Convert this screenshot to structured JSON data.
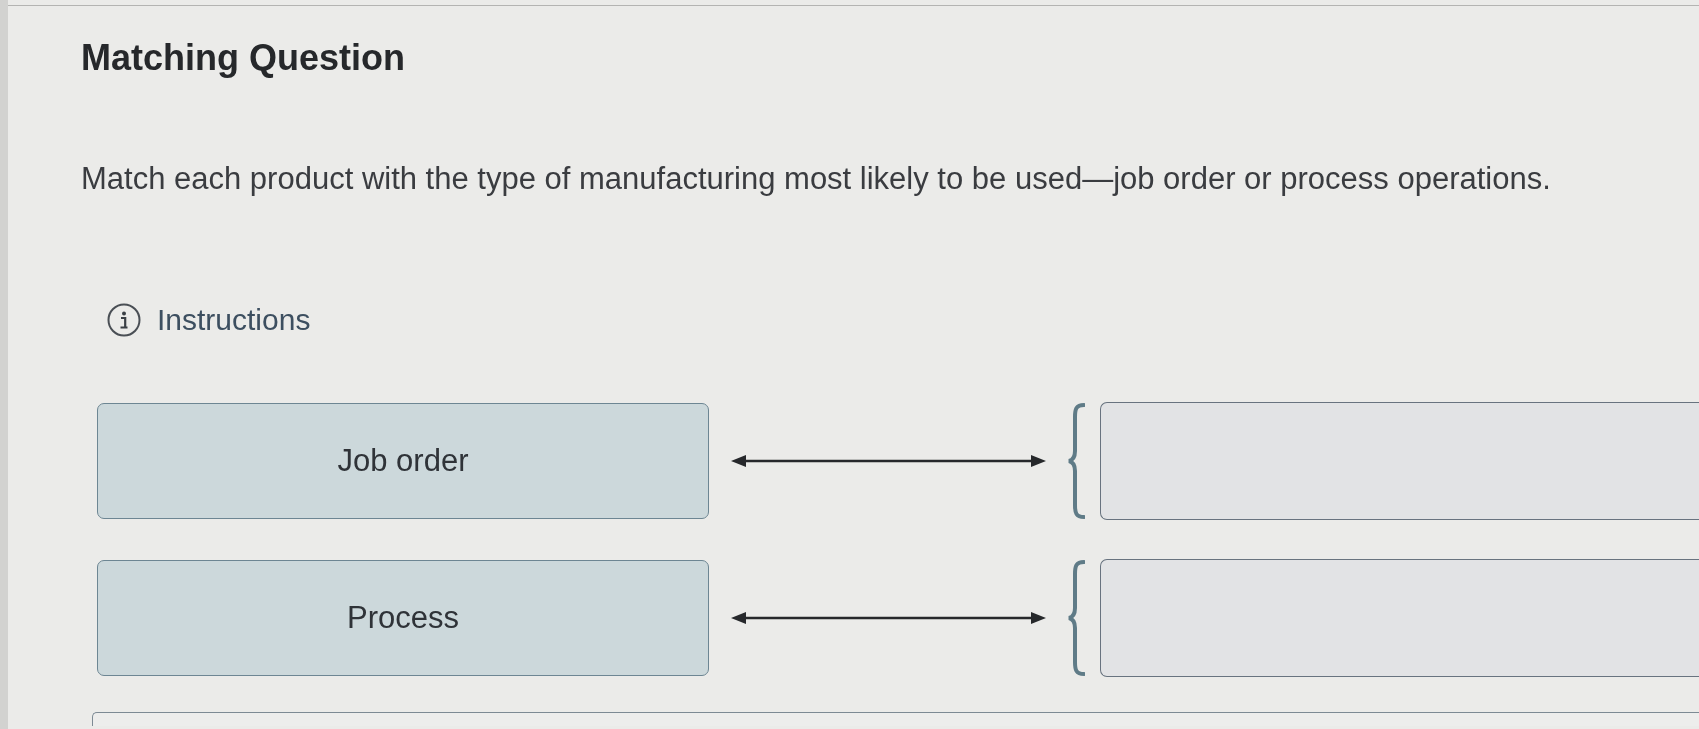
{
  "question": {
    "title": "Matching Question",
    "prompt": "Match each product with the type of manufacturing most likely to be used—job order or process operations.",
    "instructions_link": "Instructions"
  },
  "matches": [
    {
      "label": "Job order"
    },
    {
      "label": "Process"
    }
  ]
}
